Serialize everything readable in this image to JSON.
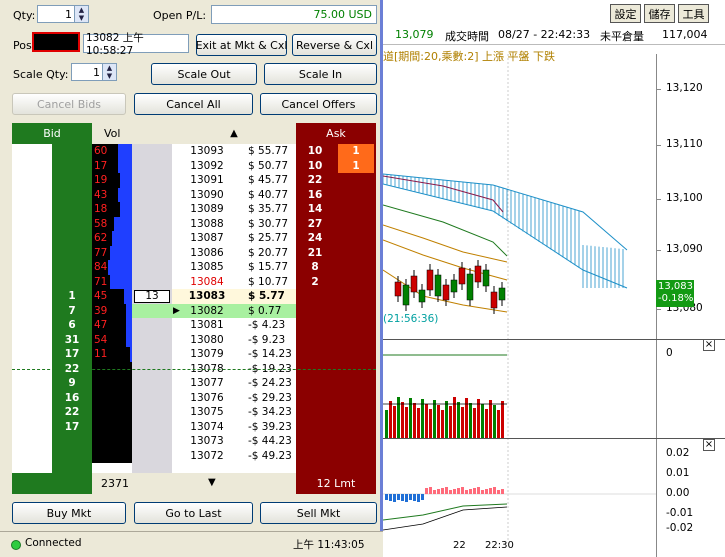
{
  "order_panel": {
    "qty_label": "Qty:",
    "qty_value": "1",
    "open_pl_label": "Open P/L:",
    "open_pl_value": "75.00 USD",
    "pos_label": "Pos",
    "position_info": "13082 上午 10:58:27",
    "exit_button": "Exit at Mkt & Cxl",
    "reverse_button": "Reverse & Cxl",
    "scale_qty_label": "Scale Qty:",
    "scale_qty_value": "1",
    "scale_out_button": "Scale Out",
    "scale_in_button": "Scale In",
    "cancel_bids_button": "Cancel Bids",
    "cancel_all_button": "Cancel All",
    "cancel_offers_button": "Cancel Offers"
  },
  "ladder": {
    "headers": {
      "bid": "Bid",
      "vol": "Vol",
      "ask": "Ask"
    },
    "up_arrow": "▲",
    "down_arrow": "▼",
    "current_price": "13083",
    "trade_qty": "13",
    "rows": [
      {
        "bid": "",
        "vol": "60",
        "vbar": 0.35,
        "price": "13093",
        "pl": "$ 55.77",
        "ask": "10",
        "myask": "1"
      },
      {
        "bid": "",
        "vol": "17",
        "vbar": 0.35,
        "price": "13092",
        "pl": "$ 50.77",
        "ask": "10",
        "myask": "1"
      },
      {
        "bid": "",
        "vol": "19",
        "vbar": 0.3,
        "price": "13091",
        "pl": "$ 45.77",
        "ask": "22",
        "myask": ""
      },
      {
        "bid": "",
        "vol": "43",
        "vbar": 0.35,
        "price": "13090",
        "pl": "$ 40.77",
        "ask": "16",
        "myask": ""
      },
      {
        "bid": "",
        "vol": "18",
        "vbar": 0.3,
        "price": "13089",
        "pl": "$ 35.77",
        "ask": "14",
        "myask": ""
      },
      {
        "bid": "",
        "vol": "58",
        "vbar": 0.45,
        "price": "13088",
        "pl": "$ 30.77",
        "ask": "27",
        "myask": ""
      },
      {
        "bid": "",
        "vol": "62",
        "vbar": 0.5,
        "price": "13087",
        "pl": "$ 25.77",
        "ask": "24",
        "myask": ""
      },
      {
        "bid": "",
        "vol": "77",
        "vbar": 0.55,
        "price": "13086",
        "pl": "$ 20.77",
        "ask": "21",
        "myask": ""
      },
      {
        "bid": "",
        "vol": "84",
        "vbar": 0.6,
        "price": "13085",
        "pl": "$ 15.77",
        "ask": "8",
        "myask": ""
      },
      {
        "bid": "",
        "vol": "71",
        "vbar": 0.55,
        "price": "13084",
        "pl": "$ 10.77",
        "ask": "2",
        "myask": ""
      },
      {
        "bid": "1",
        "vol": "45",
        "vbar": 0.2,
        "price": "13083",
        "pl": "$ 5.77",
        "ask": "",
        "myask": ""
      },
      {
        "bid": "7",
        "vol": "39",
        "vbar": 0.15,
        "price": "13082",
        "pl": "$ 0.77",
        "ask": "",
        "myask": ""
      },
      {
        "bid": "6",
        "vol": "47",
        "vbar": 0.15,
        "price": "13081",
        "pl": "-$ 4.23",
        "ask": "",
        "myask": ""
      },
      {
        "bid": "31",
        "vol": "54",
        "vbar": 0.15,
        "price": "13080",
        "pl": "-$ 9.23",
        "ask": "",
        "myask": ""
      },
      {
        "bid": "17",
        "vol": "11",
        "vbar": 0.05,
        "price": "13079",
        "pl": "-$ 14.23",
        "ask": "",
        "myask": ""
      },
      {
        "bid": "22",
        "vol": "",
        "vbar": 0,
        "price": "13078",
        "pl": "-$ 19.23",
        "ask": "",
        "myask": ""
      },
      {
        "bid": "9",
        "vol": "",
        "vbar": 0,
        "price": "13077",
        "pl": "-$ 24.23",
        "ask": "",
        "myask": ""
      },
      {
        "bid": "16",
        "vol": "",
        "vbar": 0,
        "price": "13076",
        "pl": "-$ 29.23",
        "ask": "",
        "myask": ""
      },
      {
        "bid": "22",
        "vol": "",
        "vbar": 0,
        "price": "13075",
        "pl": "-$ 34.23",
        "ask": "",
        "myask": ""
      },
      {
        "bid": "17",
        "vol": "",
        "vbar": 0,
        "price": "13074",
        "pl": "-$ 39.23",
        "ask": "",
        "myask": ""
      },
      {
        "bid": "",
        "vol": "",
        "vbar": 0,
        "price": "13073",
        "pl": "-$ 44.23",
        "ask": "",
        "myask": ""
      },
      {
        "bid": "",
        "vol": "",
        "vbar": 0,
        "price": "13072",
        "pl": "-$ 49.23",
        "ask": "",
        "myask": ""
      }
    ],
    "footer_vol": "2371",
    "footer_ask": "12 Lmt"
  },
  "bottom_buttons": {
    "buy": "Buy Mkt",
    "goto_last": "Go to Last",
    "sell": "Sell Mkt"
  },
  "status": {
    "connected": "Connected",
    "time": "上午 11:43:05"
  },
  "chart": {
    "toolbar": [
      "設定",
      "儲存",
      "工具"
    ],
    "info_price": "13,079",
    "info_label": "成交時間",
    "info_datetime": "08/27 - 22:42:33",
    "info_oi_label": "未平倉量",
    "info_oi": "117,004",
    "indicator_text": "道[期間:20,乘數:2] 上漲  平盤  下跌",
    "annotation": "(21:56:36)",
    "price_axis": [
      "13,120",
      "13,110",
      "13,100",
      "13,090",
      "13,080"
    ],
    "last_price": "13,083",
    "last_change": "-0.18%",
    "volume_axis": [
      "0"
    ],
    "osc_axis": [
      "0.02",
      "0.01",
      "0.00",
      "-0.01",
      "-0.02"
    ],
    "time_axis": [
      "22",
      "22:30"
    ],
    "colors": {
      "up": "#cc0000",
      "down": "#008000",
      "ichimoku": "#1e90c8",
      "accent": "#6b7fd6"
    }
  }
}
